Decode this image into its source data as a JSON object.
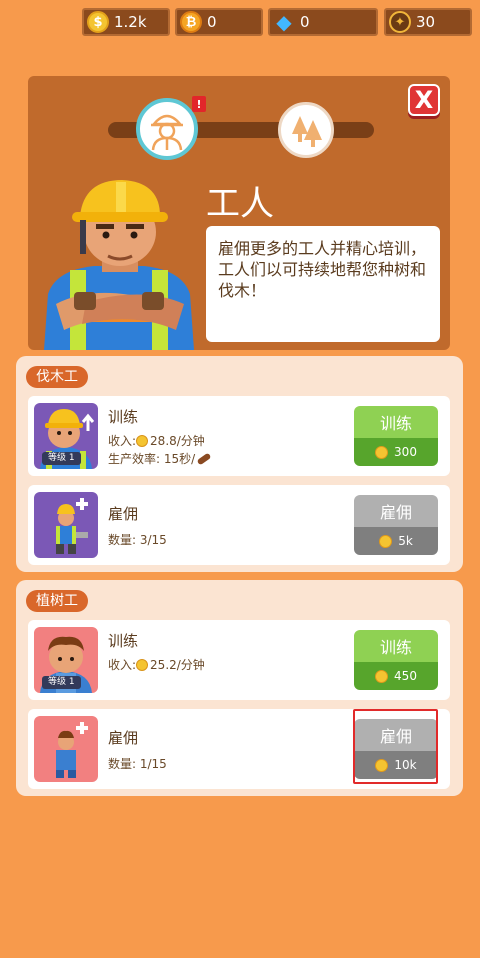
{
  "currency": {
    "cash": {
      "value": "1.2k",
      "icon": "cash-coin-icon"
    },
    "gold": {
      "value": "0",
      "icon": "bitcoin-coin-icon"
    },
    "gems": {
      "value": "0",
      "icon": "diamond-icon"
    },
    "tokens": {
      "value": "30",
      "icon": "token-icon"
    }
  },
  "panel": {
    "title": "工人",
    "description": "雇佣更多的工人并精心培训，工人们以可持续地帮您种树和伐木！",
    "alert": "!",
    "close": "X"
  },
  "section_lumber": {
    "label": "伐木工",
    "train": {
      "title": "训练",
      "level": "等级 1",
      "income_label": "收入:",
      "income_value": "28.8/分钟",
      "efficiency": "生产效率: 15秒/",
      "button_label": "训练",
      "button_cost": "300"
    },
    "hire": {
      "title": "雇佣",
      "count": "数量: 3/15",
      "button_label": "雇佣",
      "button_cost": "5k"
    }
  },
  "section_planter": {
    "label": "植树工",
    "train": {
      "title": "训练",
      "level": "等级 1",
      "income_label": "收入:",
      "income_value": "25.2/分钟",
      "button_label": "训练",
      "button_cost": "450"
    },
    "hire": {
      "title": "雇佣",
      "count": "数量: 1/15",
      "button_label": "雇佣",
      "button_cost": "10k"
    }
  },
  "colors": {
    "background": "#f79a4c",
    "panel": "#c06a2c",
    "green_button": "#8fd153",
    "gray_button": "#b0b0b0",
    "highlight": "#e12a2a"
  }
}
